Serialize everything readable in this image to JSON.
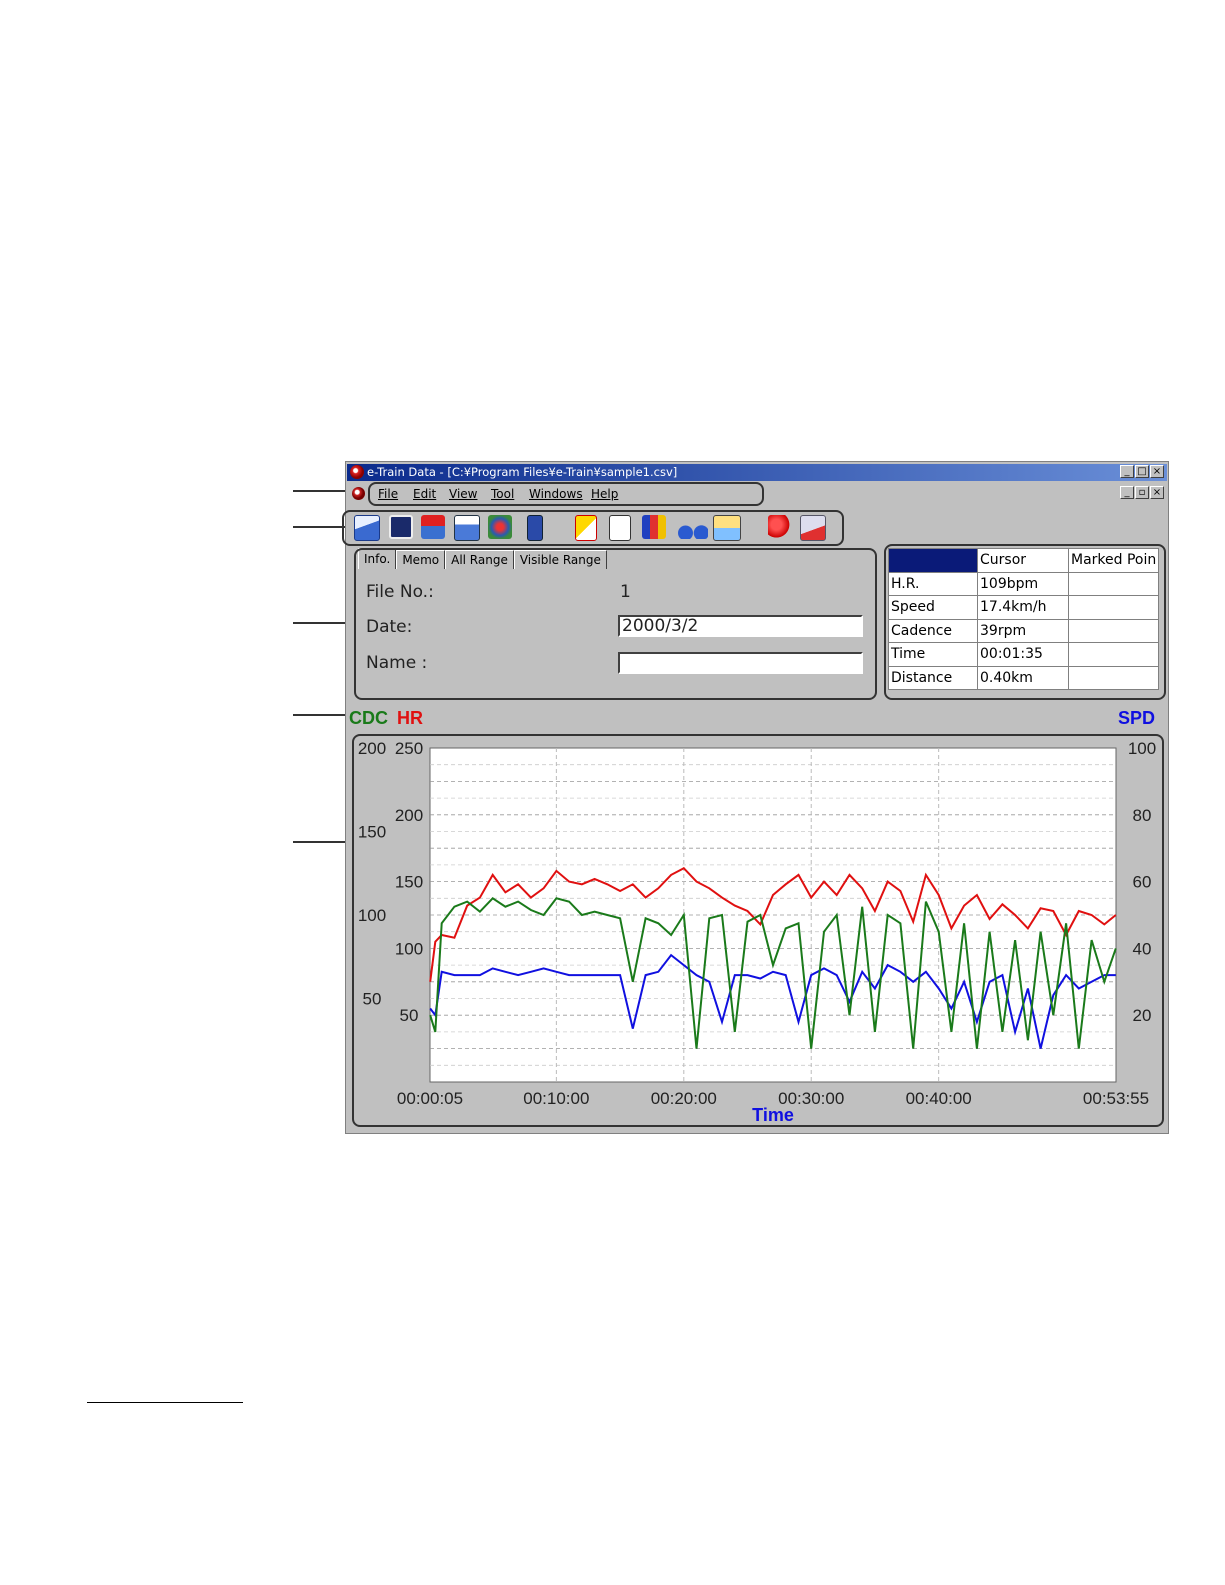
{
  "window": {
    "title": "e-Train Data - [C:¥Program Files¥e-Train¥sample1.csv]",
    "buttons": {
      "minimize": "_",
      "maximize": "□",
      "close": "×",
      "restore": "▫"
    }
  },
  "menu": {
    "items": [
      {
        "label": "File"
      },
      {
        "label": "Edit"
      },
      {
        "label": "View"
      },
      {
        "label": "Tool"
      },
      {
        "label": "Windows"
      },
      {
        "label": "Help"
      }
    ]
  },
  "toolbar": {
    "icons": [
      "open-file-icon",
      "save-disk-icon",
      "download-icon",
      "print-icon",
      "import-device-icon",
      "exit-door-icon",
      "font-a-icon",
      "font-compare-icon",
      "color-grid-icon",
      "cyclist-icon",
      "graph-area-icon",
      "heart-icon",
      "lap-icon"
    ]
  },
  "tabs": [
    {
      "label": "Info."
    },
    {
      "label": "Memo"
    },
    {
      "label": "All Range"
    },
    {
      "label": "Visible Range"
    }
  ],
  "info": {
    "file_no_label": "File No.:",
    "file_no_value": "1",
    "date_label": "Date:",
    "date_value": "2000/3/2",
    "name_label": "Name :",
    "name_value": ""
  },
  "stats": {
    "headers": [
      "",
      "Cursor",
      "Marked Poin"
    ],
    "rows": [
      {
        "label": "H.R.",
        "cursor": "109bpm",
        "marked": ""
      },
      {
        "label": "Speed",
        "cursor": "17.4km/h",
        "marked": ""
      },
      {
        "label": "Cadence",
        "cursor": "39rpm",
        "marked": ""
      },
      {
        "label": "Time",
        "cursor": "00:01:35",
        "marked": ""
      },
      {
        "label": "Distance",
        "cursor": "0.40km",
        "marked": ""
      }
    ]
  },
  "colors": {
    "cdc": "#1a7a1a",
    "hr": "#e01010",
    "spd": "#1010e0"
  },
  "chart_data": {
    "type": "line",
    "xlabel": "Time",
    "x_ticks": [
      "00:00:05",
      "00:10:00",
      "00:20:00",
      "00:30:00",
      "00:40:00",
      "00:53:55"
    ],
    "x_tick_minutes": [
      0.083,
      10,
      20,
      30,
      40,
      53.917
    ],
    "x_range_minutes": [
      0.083,
      53.917
    ],
    "axes": {
      "cdc": {
        "label": "CDC",
        "ticks": [
          "200",
          "150",
          "100",
          "50"
        ],
        "range": [
          0,
          200
        ]
      },
      "hr": {
        "label": "HR",
        "ticks": [
          "250",
          "200",
          "150",
          "100",
          "50"
        ],
        "range": [
          0,
          250
        ]
      },
      "spd": {
        "label": "SPD",
        "ticks": [
          "100",
          "80",
          "60",
          "40",
          "20"
        ],
        "range": [
          0,
          100
        ]
      }
    },
    "grid": true,
    "series": [
      {
        "name": "HR",
        "axis": "hr",
        "x": [
          0.1,
          0.5,
          1,
          2,
          3,
          4,
          5,
          6,
          7,
          8,
          9,
          10,
          11,
          12,
          13,
          14,
          15,
          16,
          17,
          18,
          19,
          20,
          21,
          22,
          23,
          24,
          25,
          26,
          27,
          28,
          29,
          30,
          31,
          32,
          33,
          34,
          35,
          36,
          37,
          38,
          39,
          40,
          41,
          42,
          43,
          44,
          45,
          46,
          47,
          48,
          49,
          50,
          51,
          52,
          53,
          53.9
        ],
        "y": [
          75,
          105,
          110,
          108,
          132,
          138,
          155,
          142,
          148,
          138,
          145,
          158,
          150,
          148,
          152,
          148,
          143,
          148,
          138,
          145,
          155,
          160,
          150,
          145,
          138,
          132,
          128,
          118,
          140,
          148,
          155,
          138,
          150,
          140,
          155,
          145,
          128,
          150,
          143,
          120,
          155,
          140,
          115,
          132,
          140,
          122,
          133,
          125,
          115,
          130,
          128,
          110,
          128,
          125,
          118,
          125
        ]
      },
      {
        "name": "SPD",
        "axis": "spd",
        "x": [
          0.1,
          0.5,
          1,
          2,
          3,
          4,
          5,
          6,
          7,
          8,
          9,
          10,
          11,
          12,
          13,
          14,
          15,
          16,
          17,
          18,
          19,
          20,
          21,
          22,
          23,
          24,
          25,
          26,
          27,
          28,
          29,
          30,
          31,
          32,
          33,
          34,
          35,
          36,
          37,
          38,
          39,
          40,
          41,
          42,
          43,
          44,
          45,
          46,
          47,
          48,
          49,
          50,
          51,
          52,
          53,
          53.9
        ],
        "y": [
          22,
          20,
          33,
          32,
          32,
          32,
          34,
          33,
          32,
          33,
          34,
          33,
          32,
          32,
          32,
          32,
          32,
          16,
          32,
          33,
          38,
          35,
          32,
          30,
          18,
          32,
          32,
          31,
          33,
          32,
          18,
          32,
          34,
          32,
          24,
          33,
          28,
          35,
          33,
          30,
          33,
          28,
          22,
          30,
          18,
          30,
          32,
          15,
          28,
          10,
          26,
          32,
          28,
          30,
          32,
          32
        ]
      },
      {
        "name": "CDC",
        "axis": "cdc",
        "x": [
          0.1,
          0.5,
          1,
          2,
          3,
          4,
          5,
          6,
          7,
          8,
          9,
          10,
          11,
          12,
          13,
          14,
          15,
          16,
          17,
          18,
          19,
          20,
          21,
          22,
          23,
          24,
          25,
          26,
          27,
          28,
          29,
          30,
          31,
          32,
          33,
          34,
          35,
          36,
          37,
          38,
          39,
          40,
          41,
          42,
          43,
          44,
          45,
          46,
          47,
          48,
          49,
          50,
          51,
          52,
          53,
          53.9
        ],
        "y": [
          40,
          30,
          95,
          105,
          108,
          102,
          110,
          105,
          108,
          103,
          100,
          110,
          108,
          100,
          102,
          100,
          98,
          60,
          98,
          95,
          88,
          100,
          20,
          98,
          100,
          30,
          96,
          100,
          70,
          92,
          95,
          20,
          90,
          100,
          40,
          105,
          30,
          100,
          95,
          20,
          108,
          90,
          30,
          95,
          20,
          90,
          30,
          85,
          25,
          90,
          40,
          95,
          20,
          85,
          60,
          80
        ]
      }
    ]
  }
}
